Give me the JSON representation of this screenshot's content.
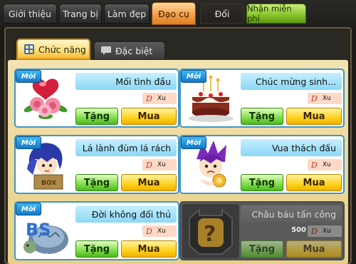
{
  "top_tabs": [
    {
      "label": "Giới thiệu",
      "state": "normal"
    },
    {
      "label": "Trang bị",
      "state": "normal"
    },
    {
      "label": "Làm đẹp",
      "state": "normal"
    },
    {
      "label": "Đạo cụ",
      "state": "active"
    },
    {
      "label": "Đổi",
      "state": "dark"
    },
    {
      "label": "Nhận miễn phí",
      "state": "green"
    }
  ],
  "sub_tabs": [
    {
      "label": "Chức năng",
      "icon": "function-icon",
      "state": "active"
    },
    {
      "label": "Đặc biệt",
      "icon": "chat-bubble-icon",
      "state": "inactive"
    }
  ],
  "items": [
    {
      "badge": "Mới",
      "name": "Mối tình đầu",
      "currency": "Xu",
      "gift": "Tặng",
      "buy": "Mua",
      "icon": "roses-heart-icon",
      "locked": false
    },
    {
      "badge": "Mới",
      "name": "Chúc mừng sinh...",
      "currency": "Xu",
      "gift": "Tặng",
      "buy": "Mua",
      "icon": "birthday-cake-icon",
      "locked": false
    },
    {
      "badge": "Mới",
      "name": "Lá lành đùm lá rách",
      "currency": "Xu",
      "gift": "Tặng",
      "buy": "Mua",
      "icon": "blue-hair-character-icon",
      "locked": false
    },
    {
      "badge": "Mới",
      "name": "Vua thách đấu",
      "currency": "Xu",
      "gift": "Tặng",
      "buy": "Mua",
      "icon": "purple-hair-character-icon",
      "locked": false
    },
    {
      "badge": "Mới",
      "name": "Đời không đối thủ",
      "currency": "Xu",
      "gift": "Tặng",
      "buy": "Mua",
      "icon": "bs-turtle-icon",
      "locked": false
    },
    {
      "badge": "",
      "name": "Châu báu tấn công",
      "price": "500",
      "currency": "Xu",
      "gift": "Tặng",
      "buy": "Mua",
      "icon": "mystery-question-icon",
      "locked": true
    }
  ],
  "colors": {
    "accent_tab": "#f3a04a",
    "card_border": "#3e97c9",
    "gift_green": "#7fdc4a",
    "buy_yellow": "#ffd21e"
  }
}
